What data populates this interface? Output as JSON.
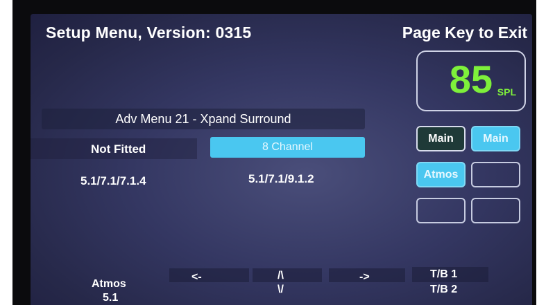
{
  "header": {
    "title": "Setup Menu, Version: 0315",
    "exit_hint": "Page Key to Exit"
  },
  "spl": {
    "value": "85",
    "unit": "SPL"
  },
  "menu": {
    "title": "Adv Menu 21 - Xpand Surround",
    "options_row1": [
      "Not Fitted",
      "8 Channel"
    ],
    "options_row2": [
      "5.1/7.1/7.1.4",
      "5.1/7.1/9.1.2"
    ],
    "selected": "8 Channel"
  },
  "side_buttons": {
    "main_left": "Main",
    "main_right": "Main",
    "atmos": "Atmos",
    "empty1": "",
    "empty2": "",
    "empty3": ""
  },
  "bottom_bar": {
    "atmos_label": "Atmos",
    "atmos_value": "5.1",
    "left": "<-",
    "up": "/\\",
    "down": "\\/",
    "right": "->",
    "tb1": "T/B 1",
    "tb2": "T/B 2"
  },
  "colors": {
    "spl_green": "#7ef03b",
    "accent_cyan": "#4ac7f0",
    "screen_bg": "#343762",
    "dark_button": "#1f3a38"
  }
}
